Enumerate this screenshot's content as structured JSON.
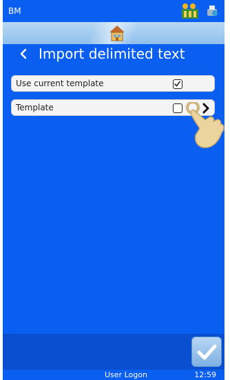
{
  "status_bar": {
    "app_label": "BM",
    "icons": [
      "label-roll-icon",
      "printer-status-icon"
    ]
  },
  "home": {
    "icon": "home-icon"
  },
  "header": {
    "back_icon": "chevron-left-icon",
    "title": "Import delimited text"
  },
  "settings": [
    {
      "label": "Use current template",
      "checked": true
    },
    {
      "label": "Template",
      "checked": false,
      "has_arrow": true
    }
  ],
  "footer": {
    "confirm_icon": "checkmark-icon"
  },
  "bottom_bar": {
    "user_logon": "User Logon",
    "time": "12:59"
  },
  "colors": {
    "background": "#0a5ef0",
    "footer": "#0a4fd0",
    "row": "#f4f4f4"
  }
}
